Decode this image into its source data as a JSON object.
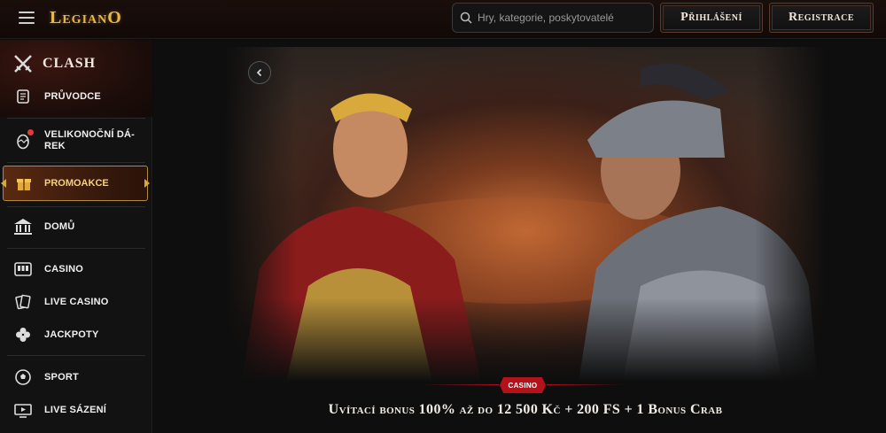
{
  "header": {
    "logo": "LegianO",
    "search_placeholder": "Hry, kategorie, poskytovatelé",
    "login_label": "Přihlášení",
    "register_label": "Registrace"
  },
  "sidebar": {
    "clash_label": "CLASH",
    "items": [
      {
        "label": "PRŮVODCE",
        "icon": "scroll-icon"
      },
      {
        "label": "VELIKONOČNÍ DÁ-\nREK",
        "icon": "egg-icon"
      },
      {
        "label": "PROMOAKCE",
        "icon": "gift-icon"
      },
      {
        "label": "DOMŮ",
        "icon": "temple-icon"
      },
      {
        "label": "CASINO",
        "icon": "slot-icon"
      },
      {
        "label": "LIVE CASINO",
        "icon": "cards-icon"
      },
      {
        "label": "JACKPOTY",
        "icon": "clover-icon"
      },
      {
        "label": "SPORT",
        "icon": "ball-icon"
      },
      {
        "label": "LIVE SÁZENÍ",
        "icon": "live-icon"
      }
    ]
  },
  "banner": {
    "tag": "CASINO",
    "headline": "Uvítací bonus 100% až do 12 500 Kč + 200 FS + 1 Bonus Crab"
  },
  "colors": {
    "accent_gold": "#e8b74a",
    "tag_red": "#b3121b",
    "background": "#0b0b0b"
  }
}
